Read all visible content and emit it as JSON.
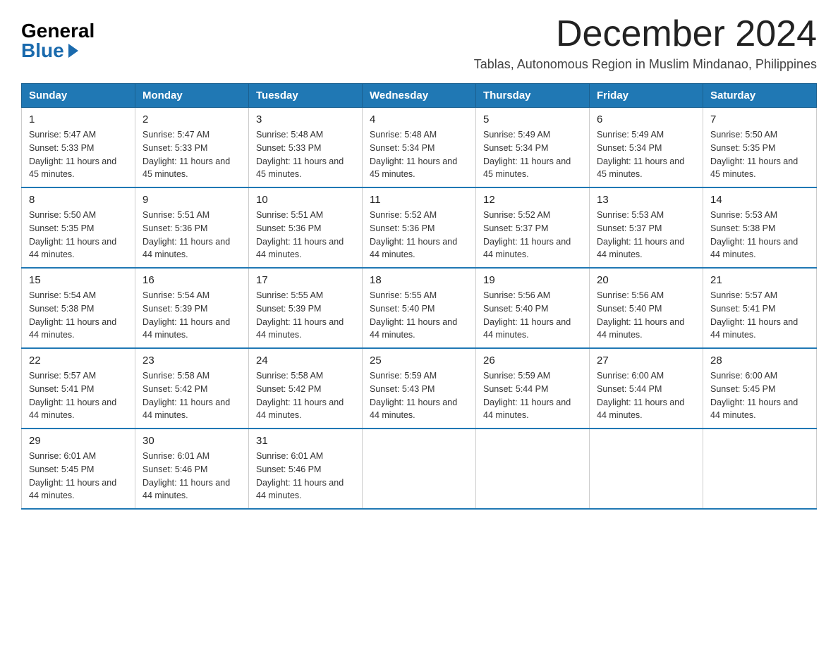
{
  "logo": {
    "general": "General",
    "blue": "Blue"
  },
  "title": "December 2024",
  "subtitle": "Tablas, Autonomous Region in Muslim Mindanao, Philippines",
  "weekdays": [
    "Sunday",
    "Monday",
    "Tuesday",
    "Wednesday",
    "Thursday",
    "Friday",
    "Saturday"
  ],
  "weeks": [
    [
      {
        "day": "1",
        "sunrise": "5:47 AM",
        "sunset": "5:33 PM",
        "daylight": "11 hours and 45 minutes."
      },
      {
        "day": "2",
        "sunrise": "5:47 AM",
        "sunset": "5:33 PM",
        "daylight": "11 hours and 45 minutes."
      },
      {
        "day": "3",
        "sunrise": "5:48 AM",
        "sunset": "5:33 PM",
        "daylight": "11 hours and 45 minutes."
      },
      {
        "day": "4",
        "sunrise": "5:48 AM",
        "sunset": "5:34 PM",
        "daylight": "11 hours and 45 minutes."
      },
      {
        "day": "5",
        "sunrise": "5:49 AM",
        "sunset": "5:34 PM",
        "daylight": "11 hours and 45 minutes."
      },
      {
        "day": "6",
        "sunrise": "5:49 AM",
        "sunset": "5:34 PM",
        "daylight": "11 hours and 45 minutes."
      },
      {
        "day": "7",
        "sunrise": "5:50 AM",
        "sunset": "5:35 PM",
        "daylight": "11 hours and 45 minutes."
      }
    ],
    [
      {
        "day": "8",
        "sunrise": "5:50 AM",
        "sunset": "5:35 PM",
        "daylight": "11 hours and 44 minutes."
      },
      {
        "day": "9",
        "sunrise": "5:51 AM",
        "sunset": "5:36 PM",
        "daylight": "11 hours and 44 minutes."
      },
      {
        "day": "10",
        "sunrise": "5:51 AM",
        "sunset": "5:36 PM",
        "daylight": "11 hours and 44 minutes."
      },
      {
        "day": "11",
        "sunrise": "5:52 AM",
        "sunset": "5:36 PM",
        "daylight": "11 hours and 44 minutes."
      },
      {
        "day": "12",
        "sunrise": "5:52 AM",
        "sunset": "5:37 PM",
        "daylight": "11 hours and 44 minutes."
      },
      {
        "day": "13",
        "sunrise": "5:53 AM",
        "sunset": "5:37 PM",
        "daylight": "11 hours and 44 minutes."
      },
      {
        "day": "14",
        "sunrise": "5:53 AM",
        "sunset": "5:38 PM",
        "daylight": "11 hours and 44 minutes."
      }
    ],
    [
      {
        "day": "15",
        "sunrise": "5:54 AM",
        "sunset": "5:38 PM",
        "daylight": "11 hours and 44 minutes."
      },
      {
        "day": "16",
        "sunrise": "5:54 AM",
        "sunset": "5:39 PM",
        "daylight": "11 hours and 44 minutes."
      },
      {
        "day": "17",
        "sunrise": "5:55 AM",
        "sunset": "5:39 PM",
        "daylight": "11 hours and 44 minutes."
      },
      {
        "day": "18",
        "sunrise": "5:55 AM",
        "sunset": "5:40 PM",
        "daylight": "11 hours and 44 minutes."
      },
      {
        "day": "19",
        "sunrise": "5:56 AM",
        "sunset": "5:40 PM",
        "daylight": "11 hours and 44 minutes."
      },
      {
        "day": "20",
        "sunrise": "5:56 AM",
        "sunset": "5:40 PM",
        "daylight": "11 hours and 44 minutes."
      },
      {
        "day": "21",
        "sunrise": "5:57 AM",
        "sunset": "5:41 PM",
        "daylight": "11 hours and 44 minutes."
      }
    ],
    [
      {
        "day": "22",
        "sunrise": "5:57 AM",
        "sunset": "5:41 PM",
        "daylight": "11 hours and 44 minutes."
      },
      {
        "day": "23",
        "sunrise": "5:58 AM",
        "sunset": "5:42 PM",
        "daylight": "11 hours and 44 minutes."
      },
      {
        "day": "24",
        "sunrise": "5:58 AM",
        "sunset": "5:42 PM",
        "daylight": "11 hours and 44 minutes."
      },
      {
        "day": "25",
        "sunrise": "5:59 AM",
        "sunset": "5:43 PM",
        "daylight": "11 hours and 44 minutes."
      },
      {
        "day": "26",
        "sunrise": "5:59 AM",
        "sunset": "5:44 PM",
        "daylight": "11 hours and 44 minutes."
      },
      {
        "day": "27",
        "sunrise": "6:00 AM",
        "sunset": "5:44 PM",
        "daylight": "11 hours and 44 minutes."
      },
      {
        "day": "28",
        "sunrise": "6:00 AM",
        "sunset": "5:45 PM",
        "daylight": "11 hours and 44 minutes."
      }
    ],
    [
      {
        "day": "29",
        "sunrise": "6:01 AM",
        "sunset": "5:45 PM",
        "daylight": "11 hours and 44 minutes."
      },
      {
        "day": "30",
        "sunrise": "6:01 AM",
        "sunset": "5:46 PM",
        "daylight": "11 hours and 44 minutes."
      },
      {
        "day": "31",
        "sunrise": "6:01 AM",
        "sunset": "5:46 PM",
        "daylight": "11 hours and 44 minutes."
      },
      null,
      null,
      null,
      null
    ]
  ]
}
